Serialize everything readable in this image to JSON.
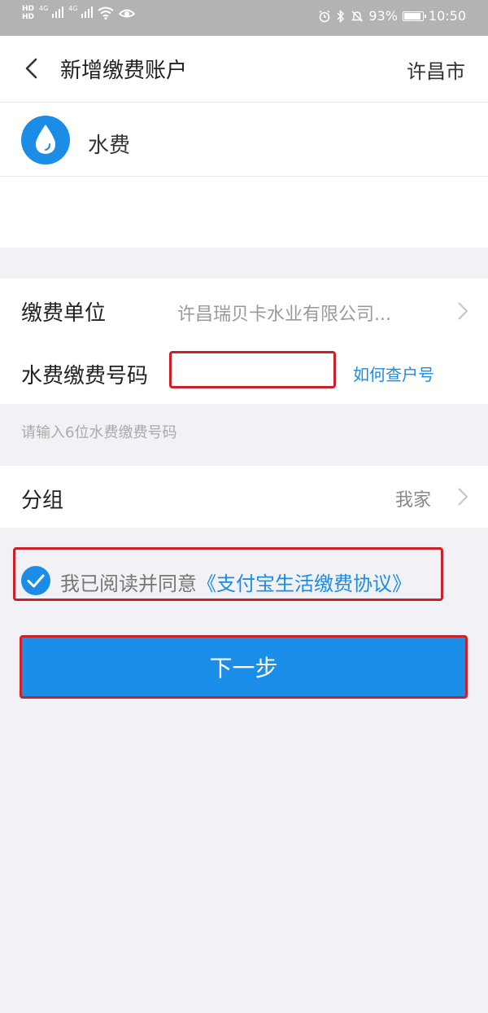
{
  "status_bar": {
    "left_label": "HD",
    "network_1": "4G",
    "network_2": "4G",
    "battery": "93%",
    "time": "10:50"
  },
  "nav": {
    "title": "新增缴费账户",
    "city": "许昌市"
  },
  "service": {
    "name": "水费",
    "icon": "water-drop-icon",
    "accent_color": "#1b8de6"
  },
  "form": {
    "unit_label": "缴费单位",
    "unit_value": "许昌瑞贝卡水业有限公司...",
    "number_label": "水费缴费号码",
    "number_value": "",
    "number_placeholder": "",
    "help_link": "如何查户号",
    "hint": "请输入6位水费缴费号码"
  },
  "group": {
    "label": "分组",
    "value": "我家"
  },
  "agreement": {
    "text": "我已阅读并同意",
    "link": "《支付宝生活缴费协议》",
    "checked": true
  },
  "next_button": "下一步",
  "colors": {
    "primary": "#1a8ee8",
    "highlight_border": "#c9202a",
    "background": "#f2f1f6"
  }
}
